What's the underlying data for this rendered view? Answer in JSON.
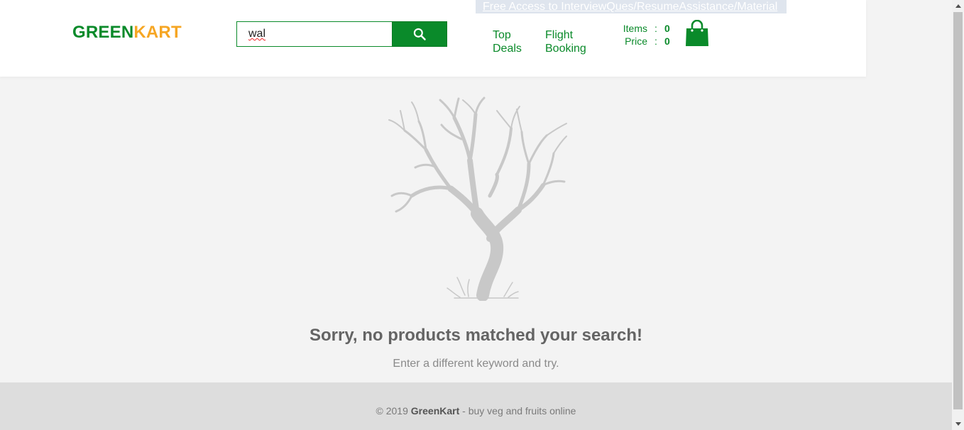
{
  "brand": {
    "part1": "GREEN",
    "part2": "KART",
    "color1": "#0a8a2a",
    "color2": "#f6a623"
  },
  "search": {
    "value": "wal",
    "button_icon": "search-icon"
  },
  "promo": {
    "text": "Free Access to InterviewQues/ResumeAssistance/Material"
  },
  "nav": [
    {
      "line1": "Top",
      "line2": "Deals"
    },
    {
      "line1": "Flight",
      "line2": "Booking"
    }
  ],
  "cart": {
    "items_label": "Items",
    "items_value": "0",
    "price_label": "Price",
    "price_value": "0",
    "separator": ":",
    "icon": "shopping-bag-icon"
  },
  "empty": {
    "illustration": "bare-tree-illustration",
    "title": "Sorry, no products matched your search!",
    "subtitle": "Enter a different keyword and try."
  },
  "footer": {
    "prefix": "© 2019 ",
    "brand": "GreenKart",
    "suffix": " - buy veg and fruits online"
  },
  "colors": {
    "accent": "#0a8a2a",
    "brand_orange": "#f6a623",
    "page_bg": "#f3f3f3",
    "footer_bg": "#dddddd"
  }
}
